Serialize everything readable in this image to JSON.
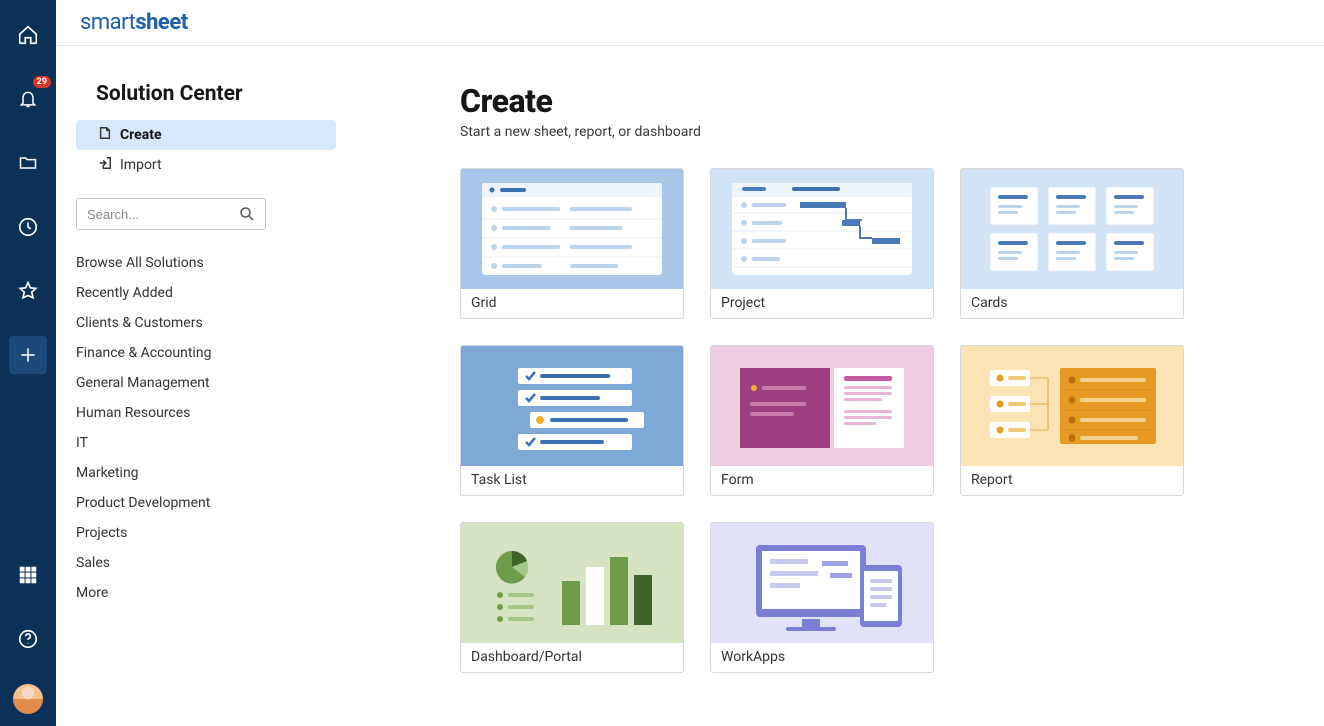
{
  "brand": {
    "first": "smart",
    "second": "sheet"
  },
  "rail": {
    "notification_count": "29"
  },
  "sidebar": {
    "title": "Solution Center",
    "items": [
      {
        "label": "Create",
        "active": true
      },
      {
        "label": "Import",
        "active": false
      }
    ],
    "search_placeholder": "Search...",
    "categories": [
      "Browse All Solutions",
      "Recently Added",
      "Clients & Customers",
      "Finance & Accounting",
      "General Management",
      "Human Resources",
      "IT",
      "Marketing",
      "Product Development",
      "Projects",
      "Sales",
      "More"
    ]
  },
  "main": {
    "title": "Create",
    "subtitle": "Start a new sheet, report, or dashboard",
    "cards": [
      {
        "label": "Grid"
      },
      {
        "label": "Project"
      },
      {
        "label": "Cards"
      },
      {
        "label": "Task List"
      },
      {
        "label": "Form"
      },
      {
        "label": "Report"
      },
      {
        "label": "Dashboard/Portal"
      },
      {
        "label": "WorkApps"
      }
    ]
  }
}
